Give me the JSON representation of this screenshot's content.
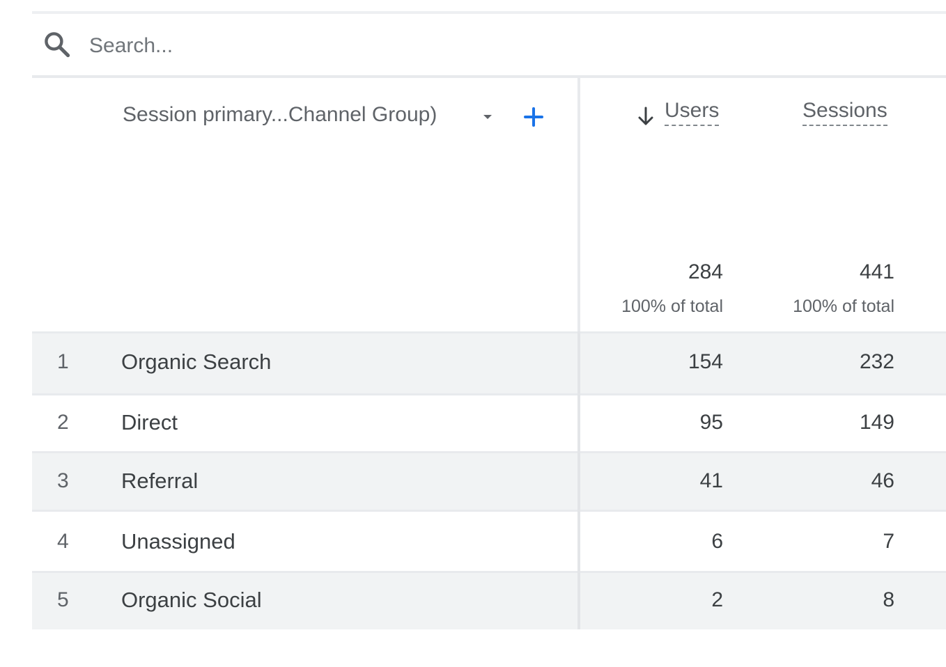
{
  "search": {
    "placeholder": "Search..."
  },
  "table": {
    "dimension_header": "Session primary...Channel Group)",
    "metrics": [
      {
        "label": "Users",
        "sorted": "descending",
        "total": "284",
        "total_pct": "100% of total"
      },
      {
        "label": "Sessions",
        "total": "441",
        "total_pct": "100% of total"
      }
    ],
    "rows": [
      {
        "index": "1",
        "name": "Organic Search",
        "users": "154",
        "sessions": "232"
      },
      {
        "index": "2",
        "name": "Direct",
        "users": "95",
        "sessions": "149"
      },
      {
        "index": "3",
        "name": "Referral",
        "users": "41",
        "sessions": "46"
      },
      {
        "index": "4",
        "name": "Unassigned",
        "users": "6",
        "sessions": "7"
      },
      {
        "index": "5",
        "name": "Organic Social",
        "users": "2",
        "sessions": "8"
      }
    ]
  },
  "colors": {
    "accent": "#1a73e8",
    "row_shade": "#f1f3f4",
    "rule": "#e8eaed",
    "text": "#3c4043",
    "muted_text": "#5f6368"
  },
  "icons": {
    "search": "search-icon",
    "dropdown": "arrow-drop-down-icon",
    "add": "plus-icon",
    "sort": "arrow-down-icon"
  }
}
